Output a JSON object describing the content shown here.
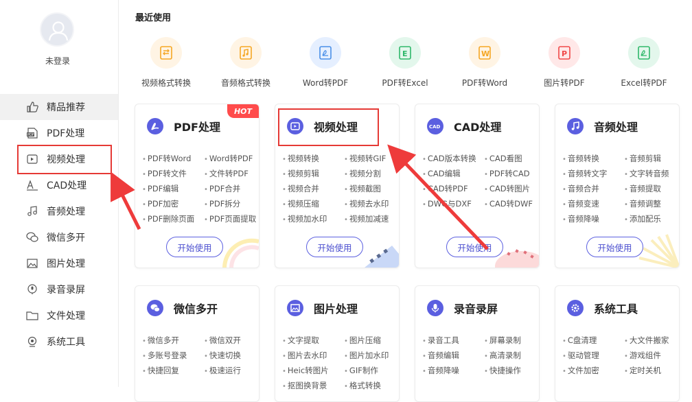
{
  "user": {
    "label": "未登录"
  },
  "sidebar": {
    "items": [
      {
        "label": "精品推荐",
        "icon": "thumbs-up-icon"
      },
      {
        "label": "PDF处理",
        "icon": "pdf-icon"
      },
      {
        "label": "视频处理",
        "icon": "video-icon"
      },
      {
        "label": "CAD处理",
        "icon": "cad-icon"
      },
      {
        "label": "音频处理",
        "icon": "music-note-icon"
      },
      {
        "label": "微信多开",
        "icon": "wechat-icon"
      },
      {
        "label": "图片处理",
        "icon": "image-icon"
      },
      {
        "label": "录音录屏",
        "icon": "microphone-icon"
      },
      {
        "label": "文件处理",
        "icon": "folder-icon"
      },
      {
        "label": "系统工具",
        "icon": "system-icon"
      }
    ]
  },
  "recent": {
    "title": "最近使用",
    "items": [
      {
        "label": "视频格式转换",
        "color": "#f5a623"
      },
      {
        "label": "音频格式转换",
        "color": "#f5a623"
      },
      {
        "label": "Word转PDF",
        "color": "#4a8fe8"
      },
      {
        "label": "PDF转Excel",
        "color": "#2fb86a"
      },
      {
        "label": "PDF转Word",
        "color": "#f5a623"
      },
      {
        "label": "图片转PDF",
        "color": "#f04848"
      },
      {
        "label": "Excel转PDF",
        "color": "#2fb86a"
      }
    ]
  },
  "cards": [
    {
      "title": "PDF处理",
      "icon": "pdf-icon",
      "hot": "HOT",
      "button": "开始使用",
      "features": [
        "PDF转Word",
        "Word转PDF",
        "PDF转文件",
        "文件转PDF",
        "PDF编辑",
        "PDF合并",
        "PDF加密",
        "PDF拆分",
        "PDF删除页面",
        "PDF页面提取"
      ]
    },
    {
      "title": "视频处理",
      "icon": "video-icon",
      "button": "开始使用",
      "features": [
        "视频转换",
        "视频转GIF",
        "视频剪辑",
        "视频分割",
        "视频合并",
        "视频截图",
        "视频压缩",
        "视频去水印",
        "视频加水印",
        "视频加减速"
      ]
    },
    {
      "title": "CAD处理",
      "icon": "cad-icon",
      "button": "开始使用",
      "features": [
        "CAD版本转换",
        "CAD看图",
        "CAD编辑",
        "PDF转CAD",
        "CAD转PDF",
        "CAD转图片",
        "DWG与DXF",
        "CAD转DWF"
      ]
    },
    {
      "title": "音频处理",
      "icon": "music-note-icon",
      "button": "开始使用",
      "features": [
        "音频转换",
        "音频剪辑",
        "音频转文字",
        "文字转音频",
        "音频合并",
        "音频提取",
        "音频变速",
        "音频调整",
        "音频降噪",
        "添加配乐"
      ]
    },
    {
      "title": "微信多开",
      "icon": "wechat-icon",
      "features": [
        "微信多开",
        "微信双开",
        "多账号登录",
        "快速切换",
        "快捷回复",
        "极速运行"
      ]
    },
    {
      "title": "图片处理",
      "icon": "image-icon",
      "features": [
        "文字提取",
        "图片压缩",
        "图片去水印",
        "图片加水印",
        "Heic转图片",
        "GIF制作",
        "抠图换背景",
        "格式转换"
      ]
    },
    {
      "title": "录音录屏",
      "icon": "microphone-icon",
      "features": [
        "录音工具",
        "屏幕录制",
        "音频编辑",
        "高清录制",
        "音频降噪",
        "快捷操作"
      ]
    },
    {
      "title": "系统工具",
      "icon": "gear-icon",
      "features": [
        "C盘清理",
        "大文件搬家",
        "驱动管理",
        "游戏组件",
        "文件加密",
        "定时关机"
      ]
    }
  ],
  "colors": {
    "accent": "#5b5fe0",
    "highlight": "#e53935",
    "hot": "#ff4b4b"
  }
}
